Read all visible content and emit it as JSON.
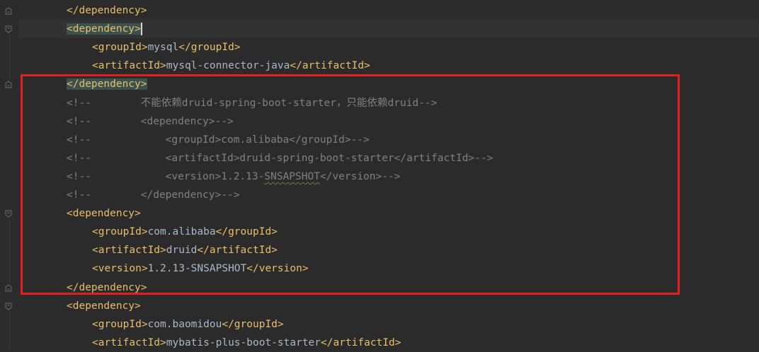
{
  "editor": {
    "lines": [
      {
        "segments": [
          {
            "t": "tag",
            "v": "</dependency>"
          }
        ]
      },
      {
        "segments": [
          {
            "t": "tag",
            "v": "<dependency>",
            "hl": true
          }
        ],
        "caret": true,
        "current": true
      },
      {
        "segments": [
          {
            "t": "tag",
            "v": "<groupId>"
          },
          {
            "t": "txt",
            "v": "mysql"
          },
          {
            "t": "tag",
            "v": "</groupId>"
          }
        ]
      },
      {
        "segments": [
          {
            "t": "tag",
            "v": "<artifactId>"
          },
          {
            "t": "txt",
            "v": "mysql-connector-java"
          },
          {
            "t": "tag",
            "v": "</artifactId>"
          }
        ]
      },
      {
        "segments": [
          {
            "t": "tag",
            "v": "</dependency>",
            "hl": true
          }
        ]
      },
      {
        "segments": [
          {
            "t": "cmt",
            "v": "<!--        不能依赖druid-spring-boot-starter，只能依赖druid-->"
          }
        ]
      },
      {
        "segments": [
          {
            "t": "cmt",
            "v": "<!--        <dependency>-->"
          }
        ]
      },
      {
        "segments": [
          {
            "t": "cmt",
            "v": "<!--            <groupId>com.alibaba</groupId>-->"
          }
        ]
      },
      {
        "segments": [
          {
            "t": "cmt",
            "v": "<!--            <artifactId>druid-spring-boot-starter</artifactId>-->"
          }
        ]
      },
      {
        "segments": [
          {
            "t": "cmt",
            "v": "<!--            <version>1.2.13-"
          },
          {
            "t": "cmt",
            "v": "SNSAPSHOT",
            "squiggle": true
          },
          {
            "t": "cmt",
            "v": "</version>-->"
          }
        ]
      },
      {
        "segments": [
          {
            "t": "cmt",
            "v": "<!--        </dependency>-->"
          }
        ]
      },
      {
        "segments": [
          {
            "t": "tag",
            "v": "<dependency>"
          }
        ]
      },
      {
        "segments": [
          {
            "t": "tag",
            "v": "<groupId>"
          },
          {
            "t": "txt",
            "v": "com.alibaba"
          },
          {
            "t": "tag",
            "v": "</groupId>"
          }
        ]
      },
      {
        "segments": [
          {
            "t": "tag",
            "v": "<artifactId>"
          },
          {
            "t": "txt",
            "v": "druid"
          },
          {
            "t": "tag",
            "v": "</artifactId>"
          }
        ]
      },
      {
        "segments": [
          {
            "t": "tag",
            "v": "<version>"
          },
          {
            "t": "txt",
            "v": "1.2.13-SNSAPSHOT"
          },
          {
            "t": "tag",
            "v": "</version>"
          }
        ]
      },
      {
        "segments": [
          {
            "t": "tag",
            "v": "</dependency>"
          }
        ]
      },
      {
        "segments": [
          {
            "t": "tag",
            "v": "<dependency>"
          }
        ]
      },
      {
        "segments": [
          {
            "t": "tag",
            "v": "<groupId>"
          },
          {
            "t": "txt",
            "v": "com.baomidou"
          },
          {
            "t": "tag",
            "v": "</groupId>"
          }
        ]
      },
      {
        "segments": [
          {
            "t": "tag",
            "v": "<artifactId>"
          },
          {
            "t": "txt",
            "v": "mybatis-plus-boot-starter"
          },
          {
            "t": "tag",
            "v": "</artifactId>"
          }
        ]
      }
    ]
  },
  "colors": {
    "background": "#2b2b2b",
    "tag": "#e8bf6a",
    "text": "#a9b7c6",
    "comment": "#808080",
    "highlight": "#3b514d",
    "annotation_box": "#e02020"
  },
  "icons": {
    "fold_open": "fold-open-icon",
    "fold_close": "fold-close-icon"
  }
}
